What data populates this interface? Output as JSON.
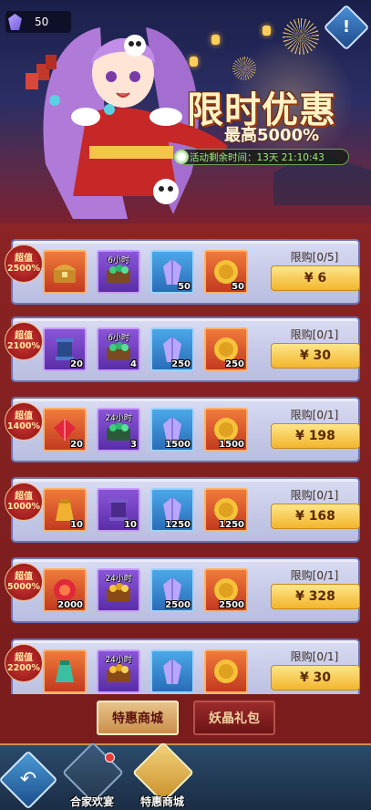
{
  "header": {
    "gem_count": "50",
    "info_label": "!",
    "title": "限时优惠",
    "subtitle": "最高5000%",
    "timer": "活动剩余时间：13天  21:10:43"
  },
  "offers": [
    {
      "badge_line1": "超值",
      "badge_line2": "2500%",
      "items": [
        {
          "icon": "treasure-chest-icon",
          "tag": "",
          "qty": ""
        },
        {
          "icon": "jade-chest-icon",
          "tag": "6小时",
          "qty": ""
        },
        {
          "icon": "crystal-icon",
          "tag": "",
          "qty": "50"
        },
        {
          "icon": "gold-coin-icon",
          "tag": "",
          "qty": "50"
        }
      ],
      "limit": "限购[0/5]",
      "price": "¥ 6"
    },
    {
      "badge_line1": "超值",
      "badge_line2": "2100%",
      "items": [
        {
          "icon": "blue-scroll-icon",
          "tag": "",
          "qty": "20"
        },
        {
          "icon": "jade-chest-icon",
          "tag": "6小时",
          "qty": "4"
        },
        {
          "icon": "crystal-icon",
          "tag": "",
          "qty": "250"
        },
        {
          "icon": "gold-coin-icon",
          "tag": "",
          "qty": "250"
        }
      ],
      "limit": "限购[0/1]",
      "price": "¥ 30"
    },
    {
      "badge_line1": "超值",
      "badge_line2": "1400%",
      "items": [
        {
          "icon": "red-gem-icon",
          "tag": "",
          "qty": "20"
        },
        {
          "icon": "jade-chest-icon",
          "tag": "24小时",
          "qty": "3"
        },
        {
          "icon": "crystal-icon",
          "tag": "",
          "qty": "1500"
        },
        {
          "icon": "gold-coin-icon",
          "tag": "",
          "qty": "1500"
        }
      ],
      "limit": "限购[0/1]",
      "price": "¥ 198"
    },
    {
      "badge_line1": "超值",
      "badge_line2": "1000%",
      "items": [
        {
          "icon": "gold-pouch-icon",
          "tag": "",
          "qty": "10"
        },
        {
          "icon": "purple-scroll-icon",
          "tag": "",
          "qty": "10"
        },
        {
          "icon": "crystal-icon",
          "tag": "",
          "qty": "1250"
        },
        {
          "icon": "gold-coin-icon",
          "tag": "",
          "qty": "1250"
        }
      ],
      "limit": "限购[0/1]",
      "price": "¥ 168"
    },
    {
      "badge_line1": "超值",
      "badge_line2": "5000%",
      "items": [
        {
          "icon": "red-gem-icon",
          "tag": "",
          "qty": "2000"
        },
        {
          "icon": "gold-chest-icon",
          "tag": "24小时",
          "qty": ""
        },
        {
          "icon": "crystal-icon",
          "tag": "",
          "qty": "2500"
        },
        {
          "icon": "gold-coin-icon",
          "tag": "",
          "qty": "2500"
        }
      ],
      "limit": "限购[0/1]",
      "price": "¥ 328"
    },
    {
      "badge_line1": "超值",
      "badge_line2": "2200%",
      "items": [
        {
          "icon": "green-pouch-icon",
          "tag": "",
          "qty": ""
        },
        {
          "icon": "gold-chest-icon",
          "tag": "24小时",
          "qty": ""
        },
        {
          "icon": "crystal-icon",
          "tag": "",
          "qty": ""
        },
        {
          "icon": "gold-coin-icon",
          "tag": "",
          "qty": ""
        }
      ],
      "limit": "限购[0/1]",
      "price": "¥ 30"
    }
  ],
  "tabs": {
    "active": "特惠商城",
    "inactive": "妖晶礼包"
  },
  "bottom_nav": {
    "back_icon": "back-arrow-icon",
    "item1": "合家欢宴",
    "item2": "特惠商城"
  },
  "colors": {
    "panel_red": "#7a1c1c",
    "card": "#c7cbe8",
    "price_gold": "#f3b52d",
    "badge_red": "#d23a3a"
  }
}
